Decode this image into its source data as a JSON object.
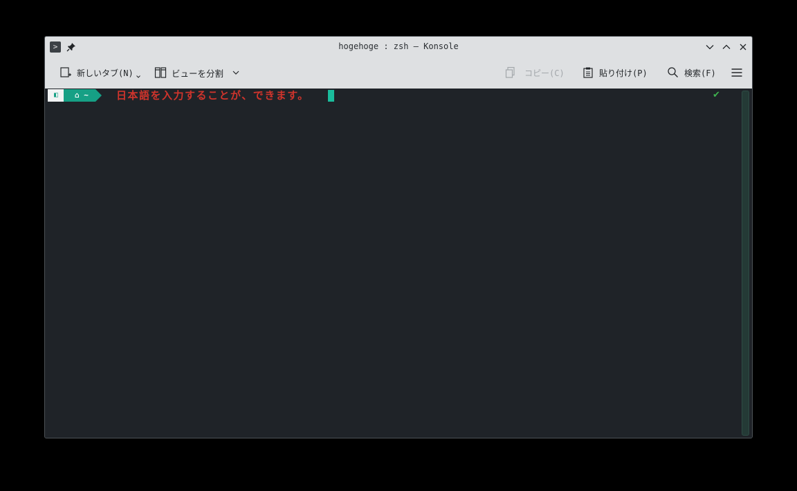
{
  "window": {
    "title": "hogehoge : zsh — Konsole",
    "app_icon": "terminal-icon"
  },
  "toolbar": {
    "new_tab_label": "新しいタブ(N)",
    "split_view_label": "ビューを分割",
    "copy_label": "コピー(C)",
    "paste_label": "貼り付け(P)",
    "search_label": "検索(F)"
  },
  "terminal": {
    "prompt_os_glyph": "◧",
    "prompt_dir": "⌂ ~",
    "command_text": "日本語を入力することが、できます。",
    "status_mark": "✔"
  },
  "colors": {
    "accent": "#16a085",
    "command_text": "#d0342c",
    "terminal_bg": "#1f2328",
    "status_ok": "#3fb34f"
  }
}
